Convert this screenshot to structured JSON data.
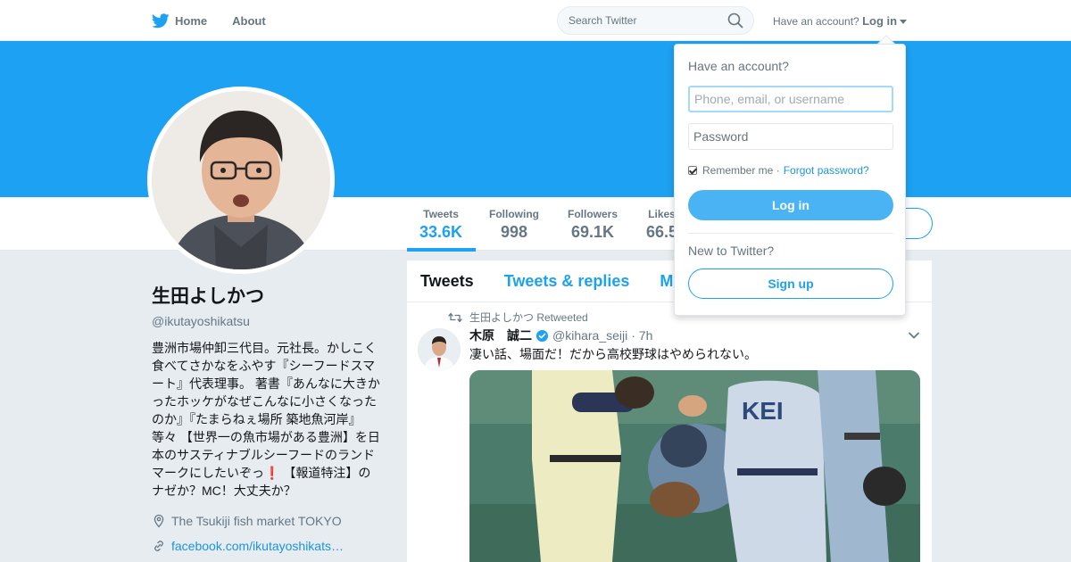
{
  "colors": {
    "brand": "#1da1f2",
    "link": "#1b95e0",
    "banner": "#1da1f2"
  },
  "nav": {
    "home_label": "Home",
    "about_label": "About",
    "search_placeholder": "Search Twitter",
    "have_account": "Have an account?",
    "login_label": "Log in"
  },
  "stats": [
    {
      "label": "Tweets",
      "value": "33.6K"
    },
    {
      "label": "Following",
      "value": "998"
    },
    {
      "label": "Followers",
      "value": "69.1K"
    },
    {
      "label": "Likes",
      "value": "66.5"
    }
  ],
  "profile": {
    "name": "生田よしかつ",
    "handle": "@ikutayoshikatsu",
    "bio_lines": [
      "豊洲市場仲卸三代目。元社長。かしこく",
      "食べてさかなをふやす『シーフードスマ",
      "ート』代表理事。 著書『あんなに大きか",
      "ったホッケがなぜこんなに小さくなった",
      "のか』『たまらねぇ場所 築地魚河岸』",
      "等々 【世界一の魚市場がある豊洲】を日",
      "本のサスティナブルシーフードのランド",
      "マークにしたいぞっ❗️ 【報道特注】の",
      "ナゼか？MC！大丈夫か？"
    ],
    "location": "The Tsukiji fish market TOKYO",
    "website": "facebook.com/ikutayoshikats…"
  },
  "timeline": {
    "tabs": [
      "Tweets",
      "Tweets & replies",
      "M"
    ],
    "retweet_text": "生田よしかつ Retweeted",
    "tweet": {
      "name": "木原　誠二",
      "handle": "@kihara_seiji",
      "time": "· 7h",
      "text": "凄い話、場面だ！だから高校野球はやめられない。"
    }
  },
  "login_dropdown": {
    "title": "Have an account?",
    "username_placeholder": "Phone, email, or username",
    "password_placeholder": "Password",
    "remember_label": "Remember me ·",
    "forgot_label": "Forgot password?",
    "login_button": "Log in",
    "new_label": "New to Twitter?",
    "signup_button": "Sign up"
  }
}
